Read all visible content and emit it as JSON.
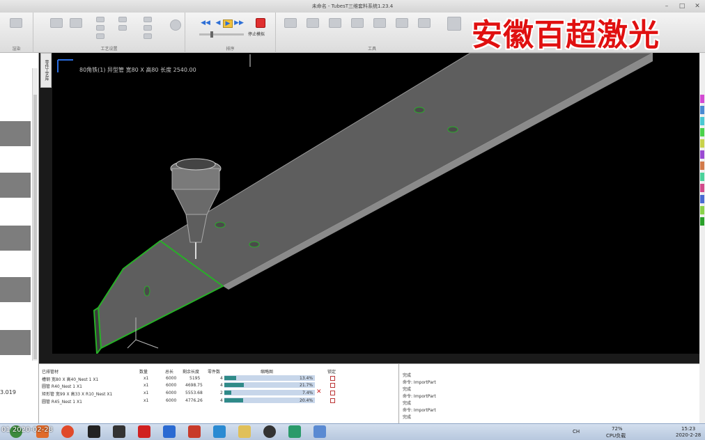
{
  "window": {
    "title": "未命名 - TubesT三维套料系统1.23.4"
  },
  "ribbon": {
    "groups": [
      {
        "label": "渲染"
      },
      {
        "label": "工艺设置"
      },
      {
        "label": "排序"
      },
      {
        "label": "工具"
      }
    ],
    "stop_label": "停止模拟"
  },
  "watermark": "安徽百超激光",
  "left_panel": {
    "footer": "3.019"
  },
  "vertical_tab": "零件工艺库",
  "viewport": {
    "part_title": "80角铁(1) 异型管 宽80 X 高80 长度 2540.00"
  },
  "nest_table": {
    "headers": [
      "已排管材",
      "数量",
      "总长",
      "剩余长度",
      "零件数",
      "缩略图",
      "锁定"
    ],
    "rows": [
      {
        "name": "槽钢 宽80 X 高40_Nest 1 X1",
        "qty": "x1",
        "total": "6000",
        "remain": "5195",
        "parts": "4",
        "pct": "13.4%",
        "util": 0.134,
        "err": false
      },
      {
        "name": "圆管 R40_Nest 1 X1",
        "qty": "x1",
        "total": "6000",
        "remain": "4698.75",
        "parts": "4",
        "pct": "21.7%",
        "util": 0.217,
        "err": false
      },
      {
        "name": "矩形管 宽99 X 高33 X R10_Nest X1",
        "qty": "x1",
        "total": "6000",
        "remain": "5553.68",
        "parts": "2",
        "pct": "7.4%",
        "util": 0.074,
        "err": true
      },
      {
        "name": "圆管 R45_Nest 1 X1",
        "qty": "x1",
        "total": "6000",
        "remain": "4776.26",
        "parts": "4",
        "pct": "20.4%",
        "util": 0.204,
        "err": false
      }
    ]
  },
  "log": {
    "lines": [
      "完成",
      "命令: ImportPart",
      "完成",
      "命令: ImportPart",
      "完成",
      "命令: ImportPart",
      "完成"
    ]
  },
  "taskbar": {
    "date_overlay": "01  2020-02-28",
    "cpu_pct": "72%",
    "cpu_label": "CPU负载",
    "time": "15:23",
    "date": "2020-2-28",
    "lang": "CH"
  },
  "colors": {
    "viewport_bg": "#000000",
    "part_edge": "#27b027",
    "bar": "#2f8a88",
    "watermark": "#e01010"
  }
}
